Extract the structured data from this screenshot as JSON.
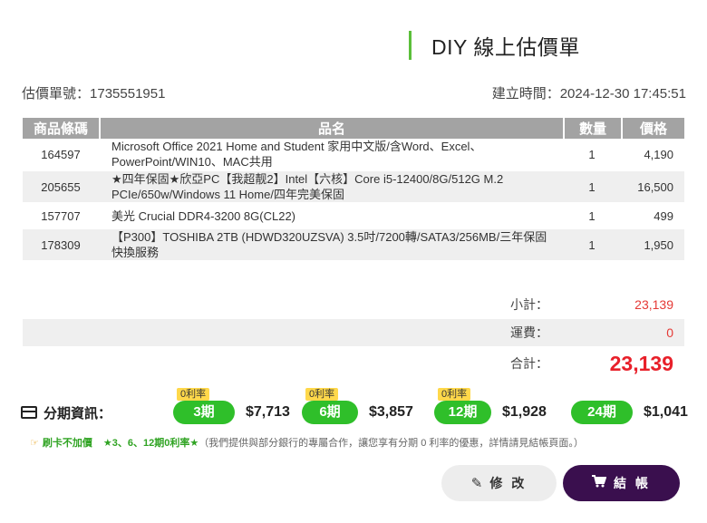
{
  "header": {
    "title": "DIY 線上估價單"
  },
  "meta": {
    "quote_no_label": "估價單號：",
    "quote_no": "1735551951",
    "created_label": "建立時間：",
    "created_at": "2024-12-30 17:45:51"
  },
  "table": {
    "headers": {
      "code": "商品條碼",
      "name": "品名",
      "qty": "數量",
      "price": "價格"
    },
    "rows": [
      {
        "code": "164597",
        "name": "Microsoft Office 2021 Home and Student 家用中文版/含Word、Excel、PowerPoint/WIN10、MAC共用",
        "qty": "1",
        "price": "4,190"
      },
      {
        "code": "205655",
        "name": "★四年保固★欣亞PC【我超靓2】Intel【六核】Core i5-12400/8G/512G M.2 PCIe/650w/Windows 11 Home/四年完美保固",
        "qty": "1",
        "price": "16,500"
      },
      {
        "code": "157707",
        "name": "美光 Crucial DDR4-3200 8G(CL22)",
        "qty": "1",
        "price": "499"
      },
      {
        "code": "178309",
        "name": "【P300】TOSHIBA 2TB (HDWD320UZSVA) 3.5吋/7200轉/SATA3/256MB/三年保固快換服務",
        "qty": "1",
        "price": "1,950"
      }
    ]
  },
  "summary": {
    "subtotal_label": "小計：",
    "subtotal": "23,139",
    "shipping_label": "運費：",
    "shipping": "0",
    "total_label": "合計：",
    "total": "23,139"
  },
  "installment": {
    "title": "分期資訊：",
    "icon": "credit-card-icon",
    "plans": [
      {
        "tag": "0利率",
        "term": "3期",
        "amount": "$7,713"
      },
      {
        "tag": "0利率",
        "term": "6期",
        "amount": "$3,857"
      },
      {
        "tag": "0利率",
        "term": "12期",
        "amount": "$1,928"
      },
      {
        "tag": "",
        "term": "24期",
        "amount": "$1,041"
      }
    ],
    "note_prefix": "刷卡不加價",
    "note_highlight": "★3、6、12期0利率★",
    "note_text": "（我們提供與部分銀行的專屬合作，讓您享有分期 0 利率的優惠，詳情請見結帳頁面。）"
  },
  "actions": {
    "edit_label": "修 改",
    "checkout_label": "結 帳"
  },
  "colors": {
    "accent_green": "#2fbf2a",
    "price_red": "#e8202a",
    "checkout_bg": "#3a0f4e",
    "header_gray": "#a3a3a3"
  }
}
